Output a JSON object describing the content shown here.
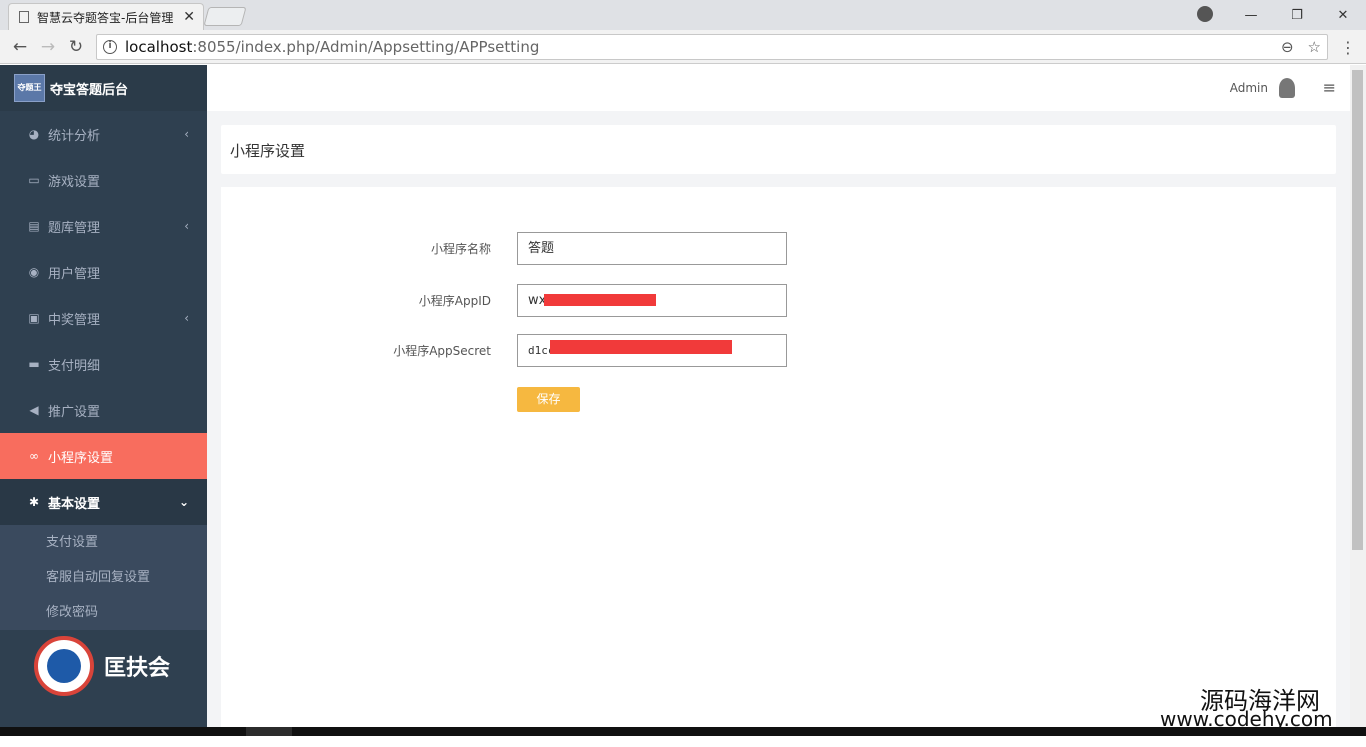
{
  "browser": {
    "tab_title": "智慧云夺题答宝-后台管理",
    "tab_close": "✕",
    "url_host": "localhost",
    "url_rest": ":8055/index.php/Admin/Appsetting/APPsetting",
    "window_controls": [
      "—",
      "❐",
      "✕"
    ]
  },
  "sidebar": {
    "brand_logo_text": "夺题王",
    "brand_name": "夺宝答题后台",
    "items": [
      {
        "label": "统计分析",
        "icon": "pie-chart-icon",
        "glyph": "◕",
        "arrow": "‹"
      },
      {
        "label": "游戏设置",
        "icon": "gamepad-icon",
        "glyph": "▭",
        "arrow": ""
      },
      {
        "label": "题库管理",
        "icon": "list-icon",
        "glyph": "▤",
        "arrow": "‹"
      },
      {
        "label": "用户管理",
        "icon": "user-icon",
        "glyph": "◉",
        "arrow": ""
      },
      {
        "label": "中奖管理",
        "icon": "portrait-icon",
        "glyph": "▣",
        "arrow": "‹"
      },
      {
        "label": "支付明细",
        "icon": "credit-card-icon",
        "glyph": "▬",
        "arrow": ""
      },
      {
        "label": "推广设置",
        "icon": "bullhorn-icon",
        "glyph": "◀",
        "arrow": ""
      },
      {
        "label": "小程序设置",
        "icon": "link-icon",
        "glyph": "∞",
        "arrow": ""
      },
      {
        "label": "基本设置",
        "icon": "cog-icon",
        "glyph": "✱",
        "arrow": "⌄"
      }
    ],
    "subitems": [
      "支付设置",
      "客服自动回复设置",
      "修改密码"
    ],
    "bottom_logo_text": "匡扶会"
  },
  "topbar": {
    "user": "Admin",
    "menu_glyph": "≡"
  },
  "panel": {
    "title": "小程序设置"
  },
  "form": {
    "name_label": "小程序名称",
    "name_value": "答题",
    "appid_label": "小程序AppID",
    "appid_value": "wx",
    "secret_label": "小程序AppSecret",
    "secret_value": "d1cc",
    "save_label": "保存"
  },
  "watermark": {
    "cn": "源码海洋网",
    "url": "www.codehy.com"
  },
  "colors": {
    "sidebar_bg": "#2f4050",
    "active_item": "#f86d5e",
    "save_button": "#f6b840",
    "redaction": "#f13a3a"
  }
}
